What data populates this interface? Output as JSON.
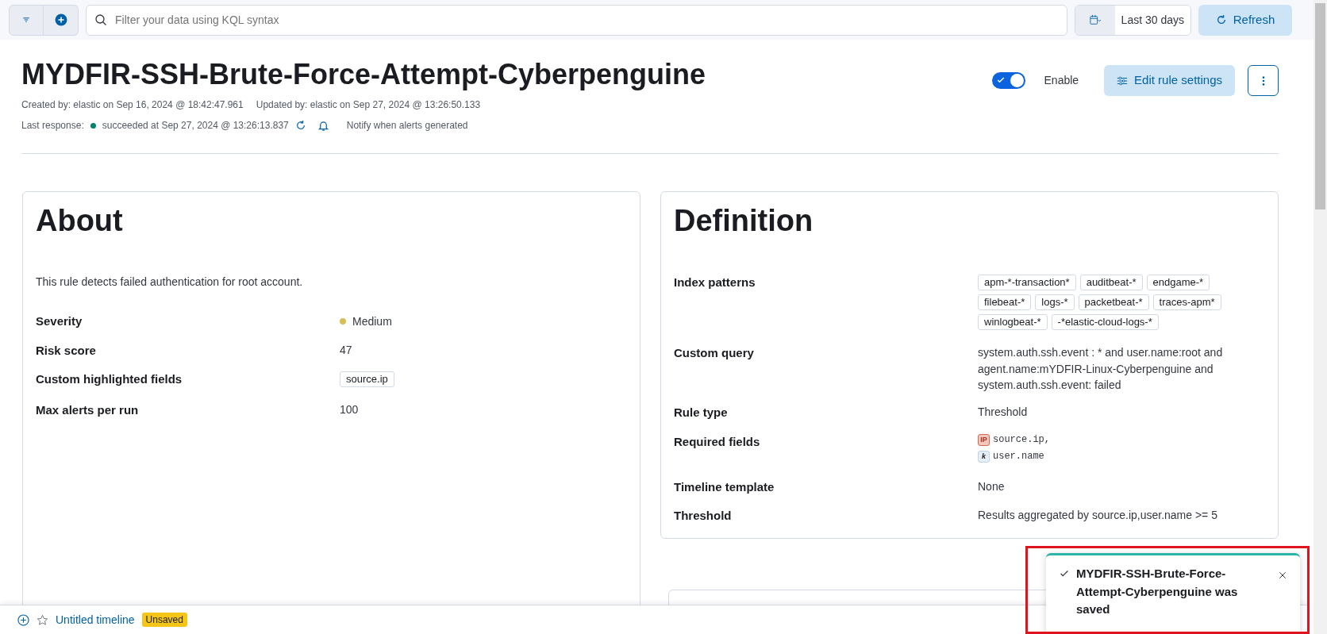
{
  "query_bar": {
    "placeholder": "Filter your data using KQL syntax",
    "date_range": "Last 30 days",
    "refresh": "Refresh"
  },
  "rule": {
    "title": "MYDFIR-SSH-Brute-Force-Attempt-Cyberpenguine",
    "created": "Created by: elastic on Sep 16, 2024 @ 18:42:47.961",
    "updated": "Updated by: elastic on Sep 27, 2024 @ 13:26:50.133",
    "last_response_label": "Last response:",
    "last_response": "succeeded at Sep 27, 2024 @ 13:26:13.837",
    "notify": "Notify when alerts generated",
    "enabled": true,
    "enable_label": "Enable",
    "edit_button": "Edit rule settings"
  },
  "about": {
    "title": "About",
    "description": "This rule detects failed authentication for root account.",
    "fields": [
      {
        "label": "Severity",
        "kind": "severity",
        "value": "Medium",
        "color": "#d6bf57"
      },
      {
        "label": "Risk score",
        "kind": "text",
        "value": "47"
      },
      {
        "label": "Custom highlighted fields",
        "kind": "tags",
        "tags": [
          "source.ip"
        ]
      },
      {
        "label": "Max alerts per run",
        "kind": "text",
        "value": "100"
      }
    ]
  },
  "definition": {
    "title": "Definition",
    "fields": [
      {
        "label": "Index patterns",
        "kind": "tags",
        "tags": [
          "apm-*-transaction*",
          "auditbeat-*",
          "endgame-*",
          "filebeat-*",
          "logs-*",
          "packetbeat-*",
          "traces-apm*",
          "winlogbeat-*",
          "-*elastic-cloud-logs-*"
        ]
      },
      {
        "label": "Custom query",
        "kind": "text",
        "value": "system.auth.ssh.event : * and user.name:root and agent.name:mYDFIR-Linux-Cyberpenguine and system.auth.ssh.event: failed"
      },
      {
        "label": "Rule type",
        "kind": "text",
        "value": "Threshold"
      },
      {
        "label": "Required fields",
        "kind": "fields",
        "fields": [
          {
            "kind": "ip",
            "badge": "IP",
            "name": "source.ip,"
          },
          {
            "kind": "keyword",
            "badge": "k",
            "name": "user.name"
          }
        ]
      },
      {
        "label": "Timeline template",
        "kind": "text",
        "value": "None"
      },
      {
        "label": "Threshold",
        "kind": "text",
        "value": "Results aggregated by source.ip,user.name >= 5"
      }
    ]
  },
  "timeline": {
    "title": "Untitled timeline",
    "status": "Unsaved"
  },
  "toast": {
    "message": "MYDFIR-SSH-Brute-Force-Attempt-Cyberpenguine was saved"
  }
}
